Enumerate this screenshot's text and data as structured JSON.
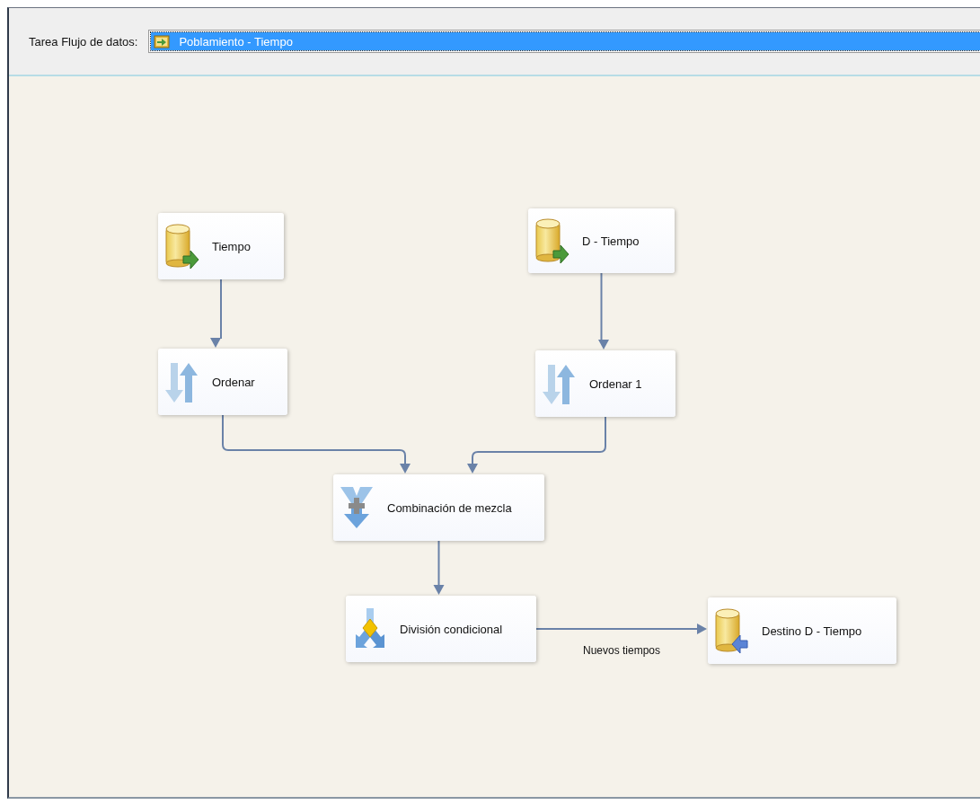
{
  "toolbar": {
    "label": "Tarea Flujo de datos:",
    "task": "Poblamiento - Tiempo"
  },
  "nodes": [
    {
      "label": "Tiempo",
      "kind": "source"
    },
    {
      "label": "D - Tiempo",
      "kind": "source"
    },
    {
      "label": "Ordenar",
      "kind": "sort"
    },
    {
      "label": "Ordenar 1",
      "kind": "sort"
    },
    {
      "label": "Combinación de mezcla",
      "kind": "merge"
    },
    {
      "label": "División condicional",
      "kind": "split"
    },
    {
      "label": "Destino D - Tiempo",
      "kind": "destination"
    }
  ],
  "connector_label": "Nuevos tiempos"
}
